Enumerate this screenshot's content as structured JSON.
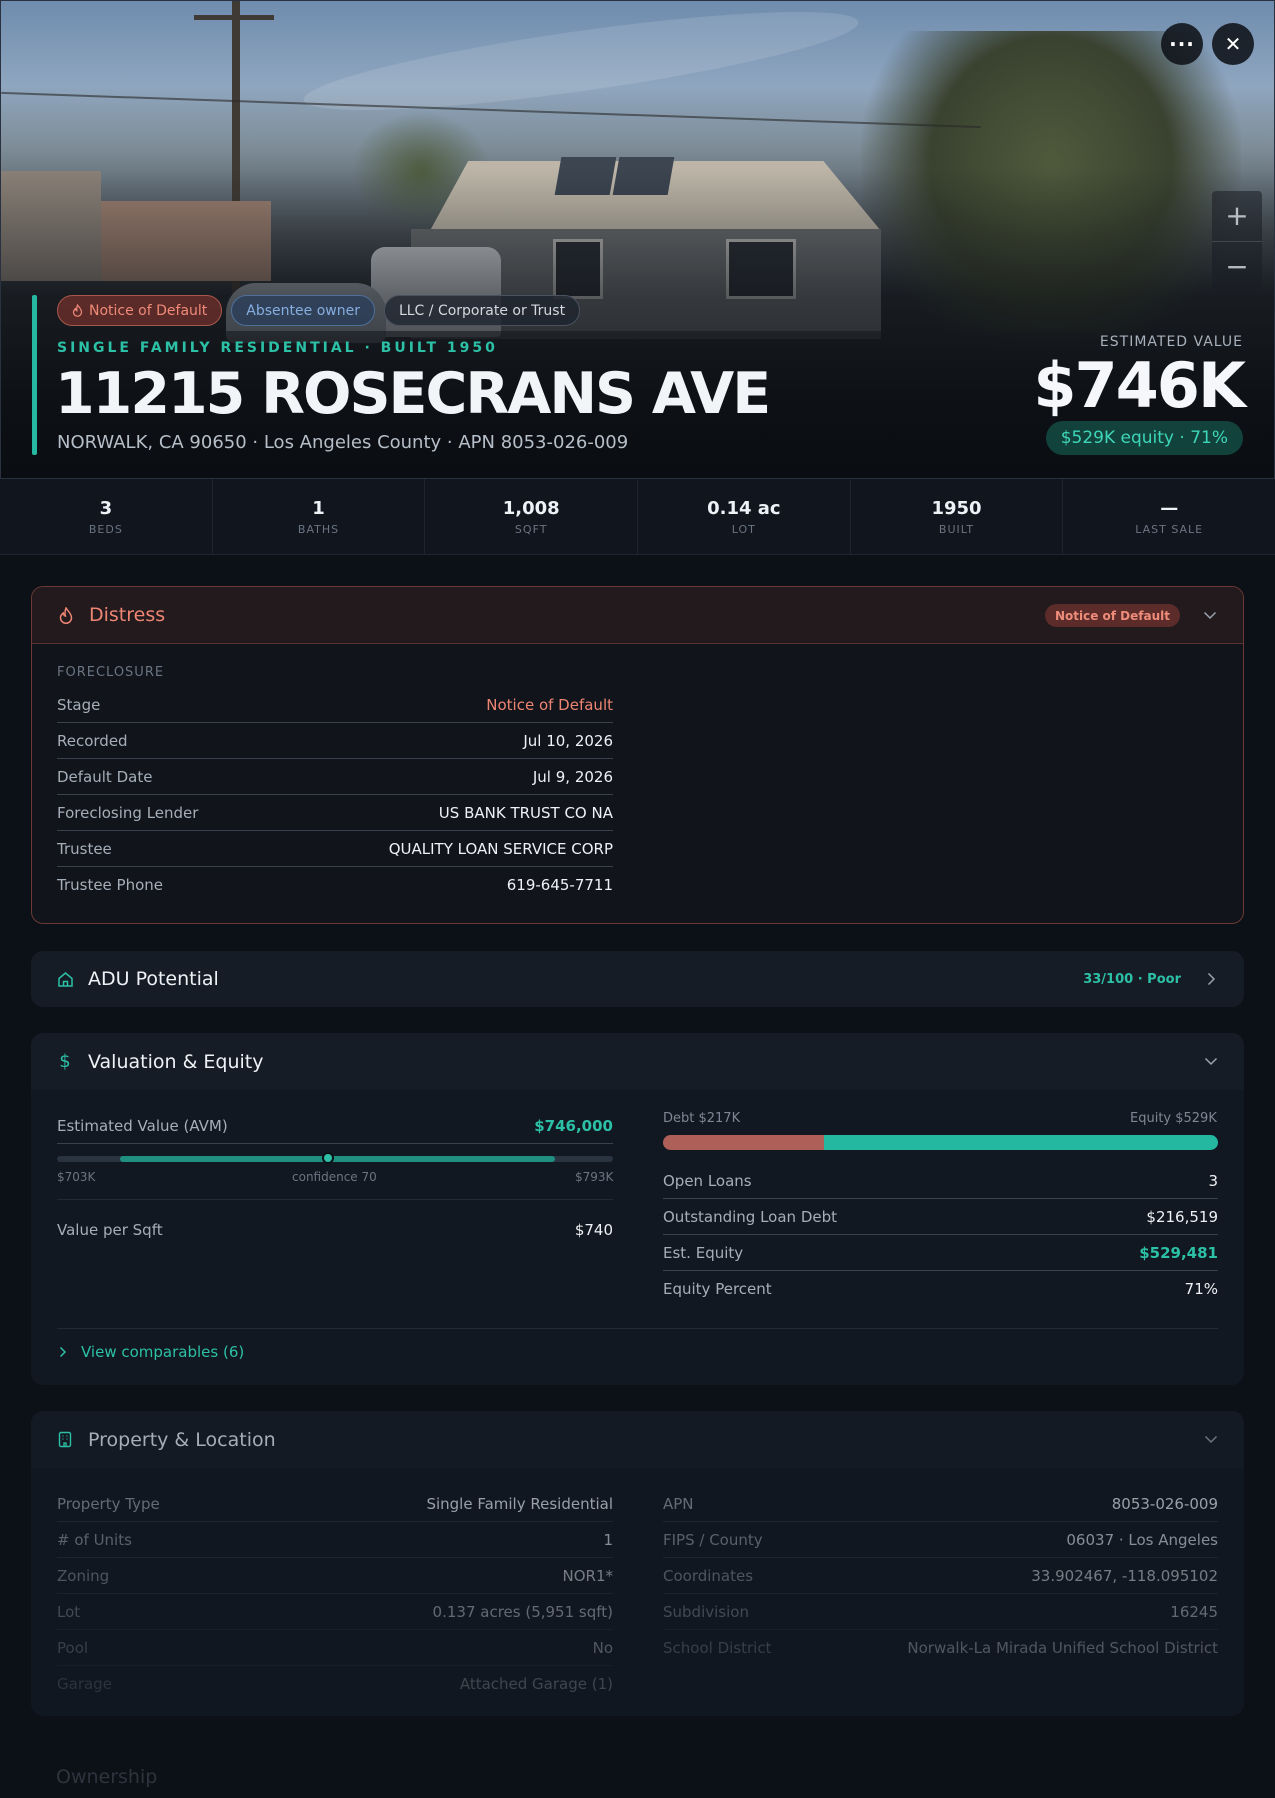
{
  "hero": {
    "tags": [
      {
        "label": "Notice of Default",
        "icon": "flame-icon"
      },
      {
        "label": "Absentee owner"
      },
      {
        "label": "LLC / Corporate or Trust"
      }
    ],
    "subtitle": "SINGLE FAMILY RESIDENTIAL · BUILT 1950",
    "address": "11215 ROSECRANS AVE",
    "location": "NORWALK, CA 90650 · Los Angeles County · APN 8053-026-009",
    "estimated_label": "ESTIMATED VALUE",
    "estimated_value": "$746K",
    "equity_pill": "$529K equity · 71%",
    "more_icon": "···",
    "close_icon": "✕",
    "zoom_in": "+",
    "zoom_out": "−"
  },
  "stats": [
    {
      "value": "3",
      "label": "BEDS"
    },
    {
      "value": "1",
      "label": "BATHS"
    },
    {
      "value": "1,008",
      "label": "SQFT"
    },
    {
      "value": "0.14 ac",
      "label": "LOT"
    },
    {
      "value": "1950",
      "label": "BUILT"
    },
    {
      "value": "—",
      "label": "LAST SALE"
    }
  ],
  "distress": {
    "title": "Distress",
    "badge": "Notice of Default",
    "section": "FORECLOSURE",
    "rows": [
      {
        "k": "Stage",
        "v": "Notice of Default"
      },
      {
        "k": "Recorded",
        "v": "Jul 10, 2026"
      },
      {
        "k": "Default Date",
        "v": "Jul 9, 2026"
      },
      {
        "k": "Foreclosing Lender",
        "v": "US BANK TRUST CO NA"
      },
      {
        "k": "Trustee",
        "v": "QUALITY LOAN SERVICE CORP"
      },
      {
        "k": "Trustee Phone",
        "v": "619-645-7711"
      }
    ],
    "accent_color": "#ee8573"
  },
  "adu": {
    "title": "ADU Potential",
    "score": "33/100 · Poor"
  },
  "valuation": {
    "title": "Valuation & Equity",
    "avm_label": "Estimated Value (AVM)",
    "avm_value": "$746,000",
    "range_low": "$703K",
    "range_high": "$793K",
    "confidence": "confidence 70",
    "range_low_value": 703,
    "range_high_value": 793,
    "value_point": 746,
    "range_min_value": 690,
    "range_max_value": 805,
    "per_sqft_label": "Value per Sqft",
    "per_sqft_value": "$740",
    "debt_label": "Debt $217K",
    "equity_label": "Equity $529K",
    "debt_fraction": 0.29,
    "rows": [
      {
        "k": "Open Loans",
        "v": "3"
      },
      {
        "k": "Outstanding Loan Debt",
        "v": "$216,519"
      },
      {
        "k": "Est. Equity",
        "v": "$529,481"
      },
      {
        "k": "Equity Percent",
        "v": "71%"
      }
    ],
    "comps_link": "View comparables (6)"
  },
  "property": {
    "title": "Property & Location",
    "left": [
      {
        "k": "Property Type",
        "v": "Single Family Residential"
      },
      {
        "k": "# of Units",
        "v": "1"
      },
      {
        "k": "Zoning",
        "v": "NOR1*"
      },
      {
        "k": "Lot",
        "v": "0.137 acres (5,951 sqft)"
      },
      {
        "k": "Pool",
        "v": "No"
      },
      {
        "k": "Garage",
        "v": "Attached Garage (1)"
      }
    ],
    "right": [
      {
        "k": "APN",
        "v": "8053-026-009"
      },
      {
        "k": "FIPS / County",
        "v": "06037 · Los Angeles"
      },
      {
        "k": "Coordinates",
        "v": "33.902467, -118.095102"
      },
      {
        "k": "Subdivision",
        "v": "16245"
      },
      {
        "k": "School District",
        "v": "Norwalk-La Mirada Unified School District"
      }
    ]
  },
  "ownership": {
    "title": "Ownership"
  }
}
